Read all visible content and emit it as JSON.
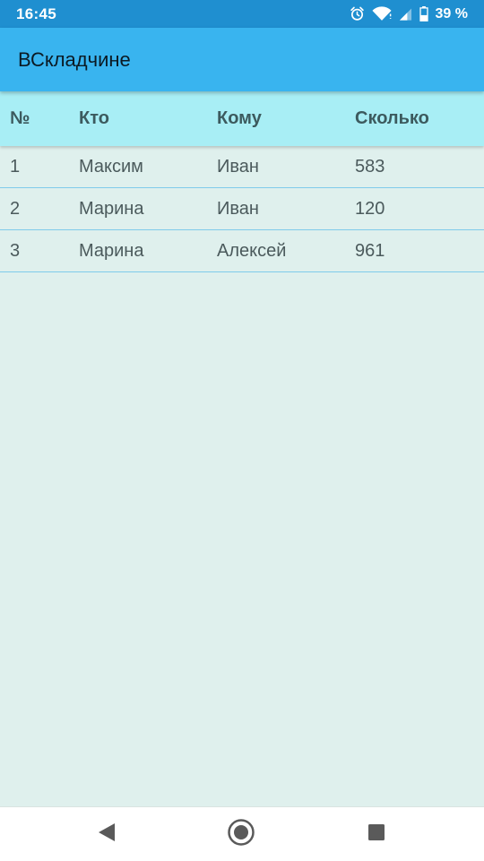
{
  "status_bar": {
    "time": "16:45",
    "battery": "39 %",
    "icons": [
      "alarm-icon",
      "wifi-icon",
      "signal-icon",
      "battery-icon"
    ]
  },
  "app_bar": {
    "title": "ВСкладчине"
  },
  "table": {
    "headers": {
      "num": "№",
      "who": "Кто",
      "to_whom": "Кому",
      "amount": "Сколько"
    },
    "rows": [
      {
        "num": "1",
        "who": "Максим",
        "to_whom": "Иван",
        "amount": "583"
      },
      {
        "num": "2",
        "who": "Марина",
        "to_whom": "Иван",
        "amount": "120"
      },
      {
        "num": "3",
        "who": "Марина",
        "to_whom": "Алексей",
        "amount": "961"
      }
    ]
  },
  "nav_bar": {
    "buttons": [
      "back-icon",
      "home-icon",
      "recents-icon"
    ]
  },
  "colors": {
    "status_bar": "#1f8fd0",
    "app_bar": "#39b4ef",
    "table_header": "#a8eef5",
    "background": "#dff0ed",
    "row_divider": "#7fcbea"
  }
}
